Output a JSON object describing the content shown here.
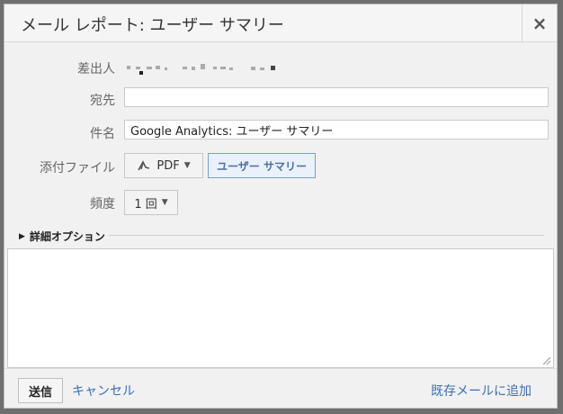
{
  "dialog": {
    "title": "メール レポート: ユーザー サマリー",
    "close_glyph": "×"
  },
  "form": {
    "from_label": "差出人",
    "to_label": "宛先",
    "to_value": "",
    "subject_label": "件名",
    "subject_value": "Google Analytics: ユーザー サマリー",
    "attachment_label": "添付ファイル",
    "attachment_format": "PDF",
    "attachment_report": "ユーザー サマリー",
    "frequency_label": "頻度",
    "frequency_value": "1 回"
  },
  "advanced_options": {
    "label": "詳細オプション"
  },
  "footer": {
    "send_label": "送信",
    "cancel_label": "キャンセル",
    "add_existing_label": "既存メールに追加"
  },
  "icons": {
    "pdf": "acrobat-icon",
    "dropdown": "caret-down-icon",
    "expand": "triangle-right-icon",
    "close": "close-icon"
  },
  "colors": {
    "link": "#3b6fb6",
    "report_button_border": "#7b9fcf"
  }
}
